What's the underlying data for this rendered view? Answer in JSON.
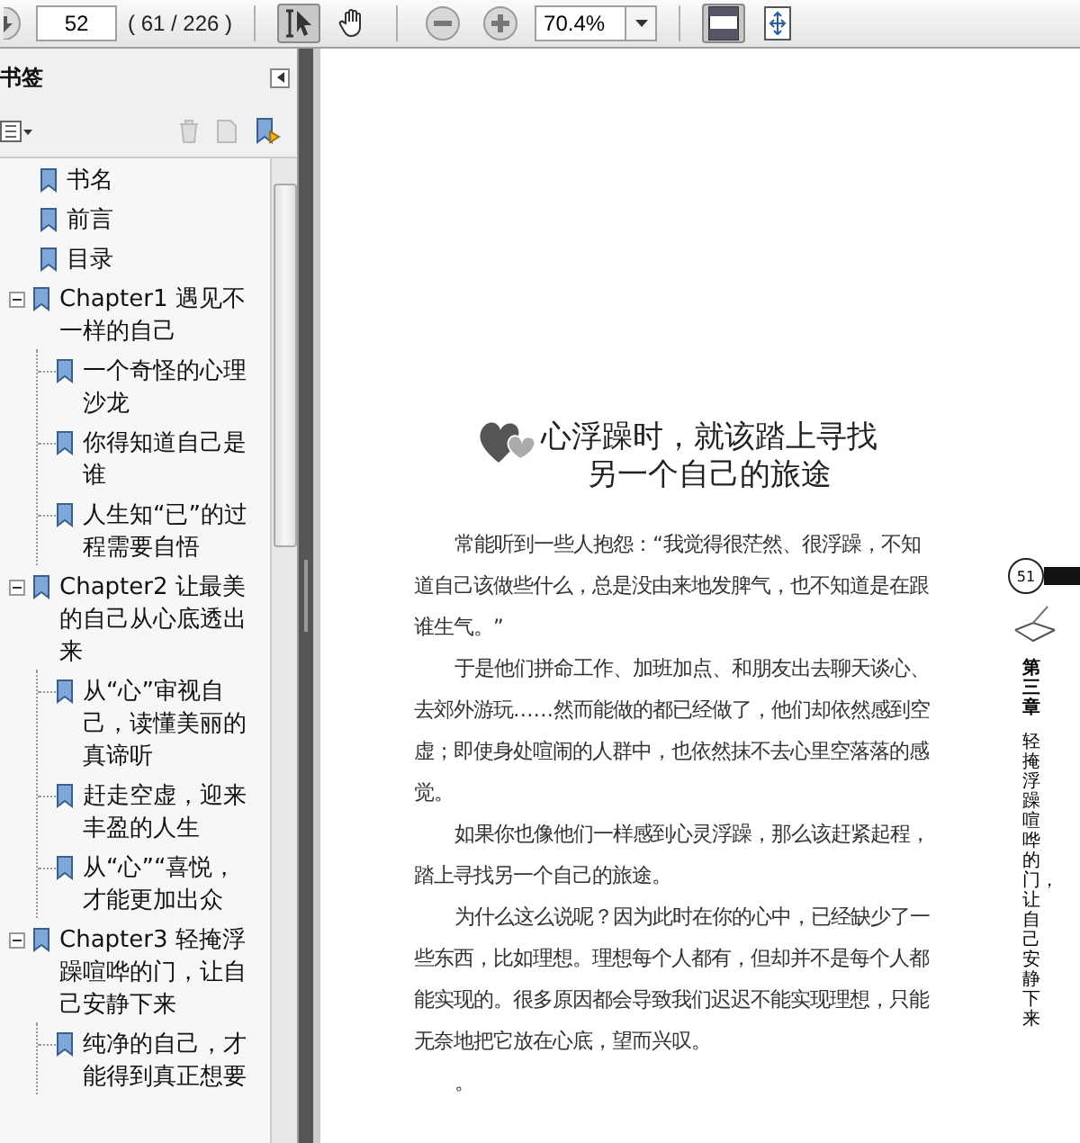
{
  "toolbar": {
    "page_number": "52",
    "page_count": "( 61 / 226 )",
    "zoom": "70.4%",
    "tools": [
      {
        "kind": "select",
        "selected": true
      },
      {
        "kind": "hand",
        "selected": false
      }
    ],
    "view_buttons": [
      {
        "kind": "fit-page",
        "selected": true
      },
      {
        "kind": "fit-width",
        "selected": false
      }
    ]
  },
  "sidebar": {
    "title": "书签",
    "bookmarks": [
      {
        "label": "书名"
      },
      {
        "label": "前言"
      },
      {
        "label": "目录"
      },
      {
        "label": "Chapter1 遇见不一样的自己",
        "expanded": true,
        "children": [
          {
            "label": "一个奇怪的心理沙龙"
          },
          {
            "label": "你得知道自己是谁"
          },
          {
            "label": "人生知“已”的过程需要自悟"
          }
        ]
      },
      {
        "label": "Chapter2 让最美的自己从心底透出来",
        "expanded": true,
        "children": [
          {
            "label": "从“心”审视自己，读懂美丽的真谛听"
          },
          {
            "label": "赶走空虚，迎来丰盈的人生"
          },
          {
            "label": "从“心”“喜悦，才能更加出众"
          }
        ]
      },
      {
        "label": "Chapter3 轻掩浮躁喧哗的门，让自己安静下来",
        "expanded": true,
        "children": [
          {
            "label": "纯净的自己，才能得到真正想要"
          }
        ]
      }
    ]
  },
  "document": {
    "title_lines": [
      "心浮躁时，就该踏上寻找",
      "另一个自己的旅途"
    ],
    "paragraphs": [
      "常能听到一些人抱怨：“我觉得很茫然、很浮躁，不知道自己该做些什么，总是没由来地发脾气，也不知道是在跟谁生气。”",
      "于是他们拼命工作、加班加点、和朋友出去聊天谈心、去郊外游玩……然而能做的都已经做了，他们却依然感到空虚；即使身处喧闹的人群中，也依然抹不去心里空落落的感觉。",
      "如果你也像他们一样感到心灵浮躁，那么该赶紧起程，踏上寻找另一个自己的旅途。",
      "为什么这么说呢？因为此时在你的心中，已经缺少了一些东西，比如理想。理想每个人都有，但却并不是每个人都能实现的。很多原因都会导致我们迟迟不能实现理想，只能无奈地把它放在心底，望而兴叹。",
      "。"
    ],
    "margin": {
      "page_number": "51",
      "chapter": "第三章",
      "chapter_title": "轻掩浮躁喧哗的门，让自己安静下来"
    }
  }
}
